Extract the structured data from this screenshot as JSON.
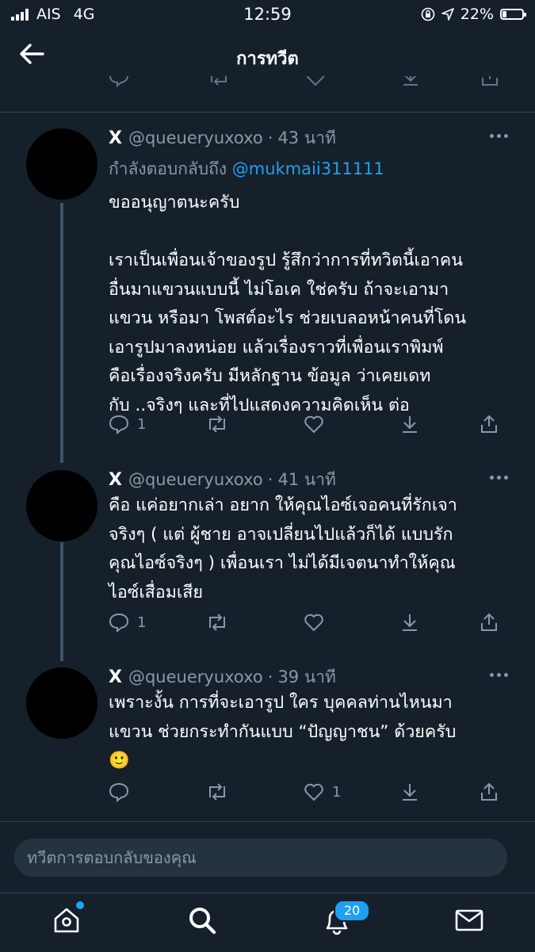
{
  "status_bar": {
    "carrier": "AIS",
    "network": "4G",
    "time": "12:59",
    "battery": "22%",
    "battery_level": 0.22,
    "icons": [
      "signal-icon",
      "orientation-lock-icon",
      "location-icon",
      "battery-icon"
    ]
  },
  "header": {
    "title": "การทวีต",
    "back_icon": "arrow-left-icon"
  },
  "tweets": [
    {
      "display_name": "X",
      "handle": "@queueryuxoxo",
      "time": "43 นาที",
      "reply_prefix": "กำลังตอบกลับถึง",
      "reply_mention": "@mukmaii311111",
      "text": "ขออนุญาตนะครับ\n\nเราเป็นเพื่อนเจ้าของรูป รู้สึกว่าการที่ทวิตนี้เอาคน\nอื่นมาแขวนแบบนี้ ไม่โอเค ใช่ครับ ถ้าจะเอามา\nแขวน หรือมา โพสต์อะไร ช่วยเบลอหน้าคนที่โดน\nเอารูปมาลงหน่อย แล้วเรื่องราวที่เพื่อนเราพิมพ์\nคือเรื่องจริงครับ มีหลักฐาน ข้อมูล ว่าเคยเดท\nกับ ..จริงๆ และที่ไปแสดงความคิดเห็น ต่อ",
      "replies": "1",
      "retweets": "",
      "likes": ""
    },
    {
      "display_name": "X",
      "handle": "@queueryuxoxo",
      "time": "41 นาที",
      "text": "คือ แค่อยากเล่า อยาก ให้คุณไอซ์เจอคนที่รักเจา\nจริงๆ ( แต่ ผู้ชาย อาจเปลี่ยนไปแล้วก็ได้ แบบรัก\nคุณไอซ์จริงๆ ) เพื่อนเรา ไม่ได้มีเจตนาทำให้คุณ\nไอซ์เสื่อมเสีย",
      "replies": "1",
      "retweets": "",
      "likes": ""
    },
    {
      "display_name": "X",
      "handle": "@queueryuxoxo",
      "time": "39 นาที",
      "text": "เพราะงั้น การที่จะเอารูป ใคร บุคคลท่านไหนมา\nแขวน ช่วยกระทำกันแบบ “ปัญญาชน” ด้วยครับ\n🙂",
      "replies": "",
      "retweets": "",
      "likes": "1"
    }
  ],
  "reply_bar": {
    "placeholder": "ทวีตการตอบกลับของคุณ"
  },
  "tab_bar": {
    "notifications_count": "20",
    "tabs": [
      "home-icon",
      "search-icon",
      "notifications-icon",
      "messages-icon"
    ]
  },
  "colors": {
    "background": "#15202b",
    "secondary_text": "#8899a6",
    "accent": "#1da1f2",
    "divider": "#38444d"
  }
}
